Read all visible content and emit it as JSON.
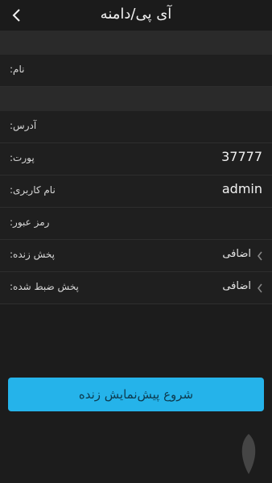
{
  "header": {
    "title": "آی پی/دامنه"
  },
  "rows": {
    "name": {
      "label": "نام:"
    },
    "address": {
      "label": "آدرس:"
    },
    "port": {
      "label": "پورت:",
      "value": "37777"
    },
    "username": {
      "label": "نام کاربری:",
      "value": "admin"
    },
    "password": {
      "label": "رمز عبور:"
    },
    "live": {
      "label": "پخش زنده:",
      "extra": "اضافی"
    },
    "playback": {
      "label": "پخش ضبط شده:",
      "extra": "اضافی"
    }
  },
  "start_button": {
    "label": "شروع پیش‌نمایش زنده"
  },
  "icons": {
    "back": "chevron-left-icon",
    "expand": "chevron-left-icon"
  },
  "colors": {
    "background": "#1c1c1c",
    "row": "#1f1f1f",
    "accent": "#25b3ea"
  }
}
